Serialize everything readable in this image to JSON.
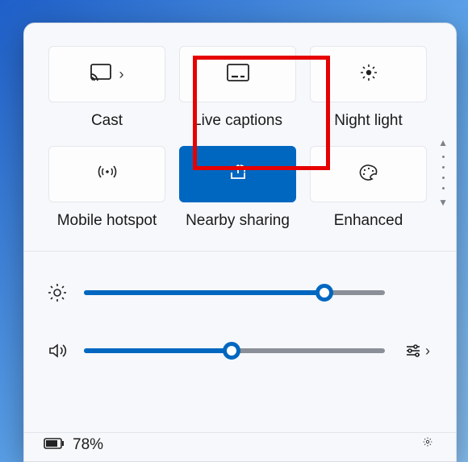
{
  "tiles": {
    "cast": {
      "label": "Cast",
      "active": false
    },
    "captions": {
      "label": "Live captions",
      "active": false
    },
    "nightlight": {
      "label": "Night light",
      "active": false
    },
    "hotspot": {
      "label": "Mobile hotspot",
      "active": false
    },
    "nearby": {
      "label": "Nearby sharing",
      "active": true
    },
    "enhanced": {
      "label": "Enhanced",
      "active": false
    }
  },
  "sliders": {
    "brightness": {
      "value_pct": 80
    },
    "volume": {
      "value_pct": 49
    }
  },
  "bottom": {
    "battery_pct": "78%"
  },
  "colors": {
    "accent": "#0067c0",
    "highlight": "#e60000"
  }
}
